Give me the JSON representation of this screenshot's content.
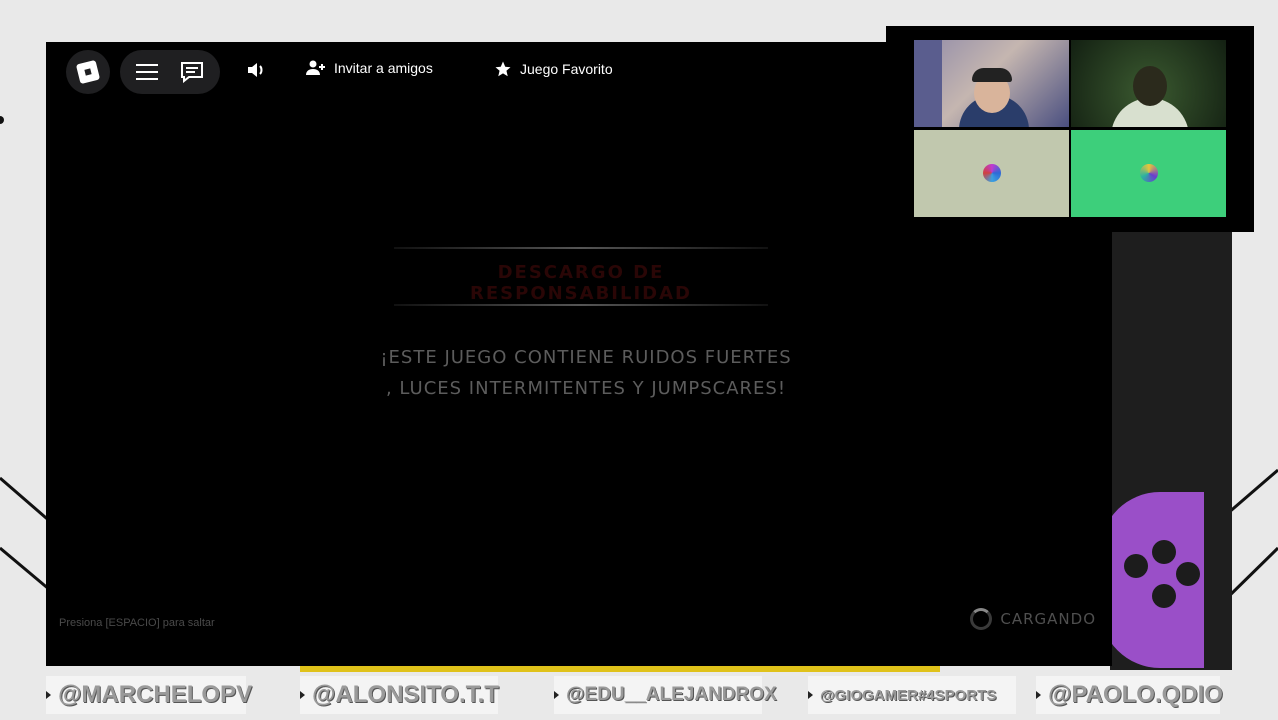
{
  "window": {
    "title": "Roblox"
  },
  "topbar": {
    "invite_label": "Invitar a amigos",
    "favorite_label": "Juego Favorito"
  },
  "loading_screen": {
    "disclaimer_title": "DESCARGO DE RESPONSABILIDAD",
    "warning_line1": "¡ESTE JUEGO CONTIENE RUIDOS FUERTES",
    "warning_line2": ", LUCES INTERMITENTES Y JUMPSCARES!",
    "hint": "Presiona [ESPACIO] para saltar",
    "status": "CARGANDO"
  },
  "overlay": {
    "handles": [
      "@MARCHELOPV",
      "@ALONSITO.T.T",
      "@EDU__ALEJANDROX",
      "@GIOGAMER#4SPORTS",
      "@PAOLO.QDIO"
    ]
  },
  "call_tiles": [
    "camera",
    "camera",
    "avatar",
    "avatar"
  ],
  "colors": {
    "accent_purple": "#9a4fc8",
    "call_green": "#3dcf7b",
    "disclaimer_red": "#2a0606"
  }
}
